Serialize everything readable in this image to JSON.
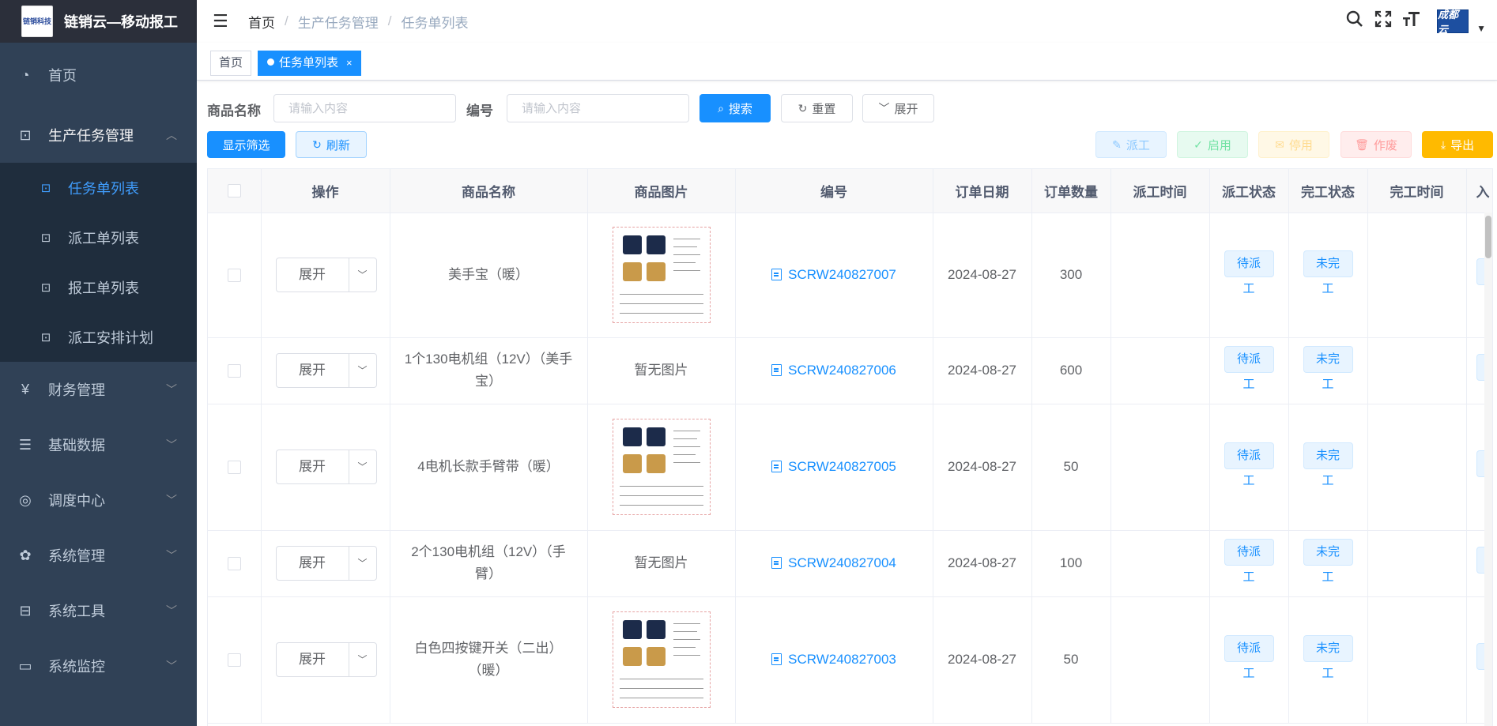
{
  "app": {
    "title": "链销云—移动报工",
    "logo_text": "链销科技"
  },
  "sidebar": {
    "items": [
      {
        "label": "首页",
        "icon": "dashboard-icon"
      },
      {
        "label": "生产任务管理",
        "icon": "task-icon",
        "open": true,
        "children": [
          {
            "label": "任务单列表",
            "active": true
          },
          {
            "label": "派工单列表"
          },
          {
            "label": "报工单列表"
          },
          {
            "label": "派工安排计划"
          }
        ]
      },
      {
        "label": "财务管理",
        "icon": "yen-icon"
      },
      {
        "label": "基础数据",
        "icon": "list-icon"
      },
      {
        "label": "调度中心",
        "icon": "check-circle-icon"
      },
      {
        "label": "系统管理",
        "icon": "gear-icon"
      },
      {
        "label": "系统工具",
        "icon": "toolbox-icon"
      },
      {
        "label": "系统监控",
        "icon": "monitor-icon"
      }
    ]
  },
  "navbar": {
    "breadcrumb": [
      "首页",
      "生产任务管理",
      "任务单列表"
    ],
    "avatar_text": "成都云"
  },
  "tags": {
    "home": "首页",
    "active": "任务单列表",
    "close": "×"
  },
  "search": {
    "name_label": "商品名称",
    "name_placeholder": "请输入内容",
    "code_label": "编号",
    "code_placeholder": "请输入内容",
    "search_btn": "搜索",
    "reset_btn": "重置",
    "expand_btn": "展开"
  },
  "toolbar": {
    "show_filter": "显示筛选",
    "refresh": "刷新",
    "dispatch": "派工",
    "enable": "启用",
    "disable": "停用",
    "void": "作废",
    "export": "导出"
  },
  "table": {
    "columns": [
      "操作",
      "商品名称",
      "商品图片",
      "编号",
      "订单日期",
      "订单数量",
      "派工时间",
      "派工状态",
      "完工状态",
      "完工时间",
      "入"
    ],
    "expand_label": "展开",
    "no_image": "暂无图片",
    "rows": [
      {
        "name": "美手宝（暖）",
        "has_image": true,
        "code": "SCRW240827007",
        "date": "2024-08-27",
        "qty": "300",
        "dispatch_time": "",
        "dispatch_status": "待派工",
        "finish_status": "未完工",
        "finish_time": ""
      },
      {
        "name": "1个130电机组（12V）（美手宝）",
        "has_image": false,
        "code": "SCRW240827006",
        "date": "2024-08-27",
        "qty": "600",
        "dispatch_time": "",
        "dispatch_status": "待派工",
        "finish_status": "未完工",
        "finish_time": ""
      },
      {
        "name": "4电机长款手臂带（暖）",
        "has_image": true,
        "code": "SCRW240827005",
        "date": "2024-08-27",
        "qty": "50",
        "dispatch_time": "",
        "dispatch_status": "待派工",
        "finish_status": "未完工",
        "finish_time": ""
      },
      {
        "name": "2个130电机组（12V）（手臂）",
        "has_image": false,
        "code": "SCRW240827004",
        "date": "2024-08-27",
        "qty": "100",
        "dispatch_time": "",
        "dispatch_status": "待派工",
        "finish_status": "未完工",
        "finish_time": ""
      },
      {
        "name": "白色四按键开关（二出）（暖）",
        "has_image": true,
        "code": "SCRW240827003",
        "date": "2024-08-27",
        "qty": "50",
        "dispatch_time": "",
        "dispatch_status": "待派工",
        "finish_status": "未完工",
        "finish_time": ""
      }
    ]
  }
}
